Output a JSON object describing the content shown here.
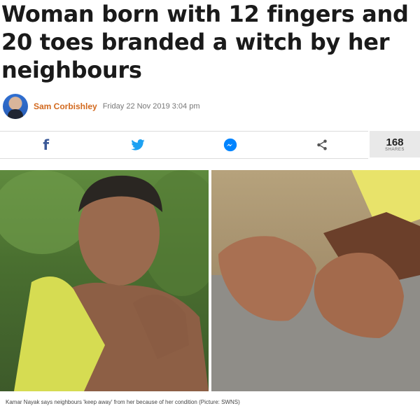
{
  "article": {
    "headline": "Woman born with 12 fingers and 20 toes branded a witch by her neighbours",
    "author": "Sam Corbishley",
    "date": "Friday 22 Nov 2019 3:04 pm"
  },
  "share": {
    "facebook_icon": "facebook-icon",
    "twitter_icon": "twitter-icon",
    "messenger_icon": "messenger-icon",
    "share_icon": "share-icon",
    "count": "168",
    "count_label": "SHARES"
  },
  "image": {
    "caption": "Kamar Nayak says neighbours 'keep away' from her because of her condition (Picture: SWNS)"
  },
  "colors": {
    "author": "#d2691e",
    "facebook": "#3b5998",
    "twitter": "#1da1f2",
    "messenger": "#0084ff",
    "share": "#555555"
  }
}
